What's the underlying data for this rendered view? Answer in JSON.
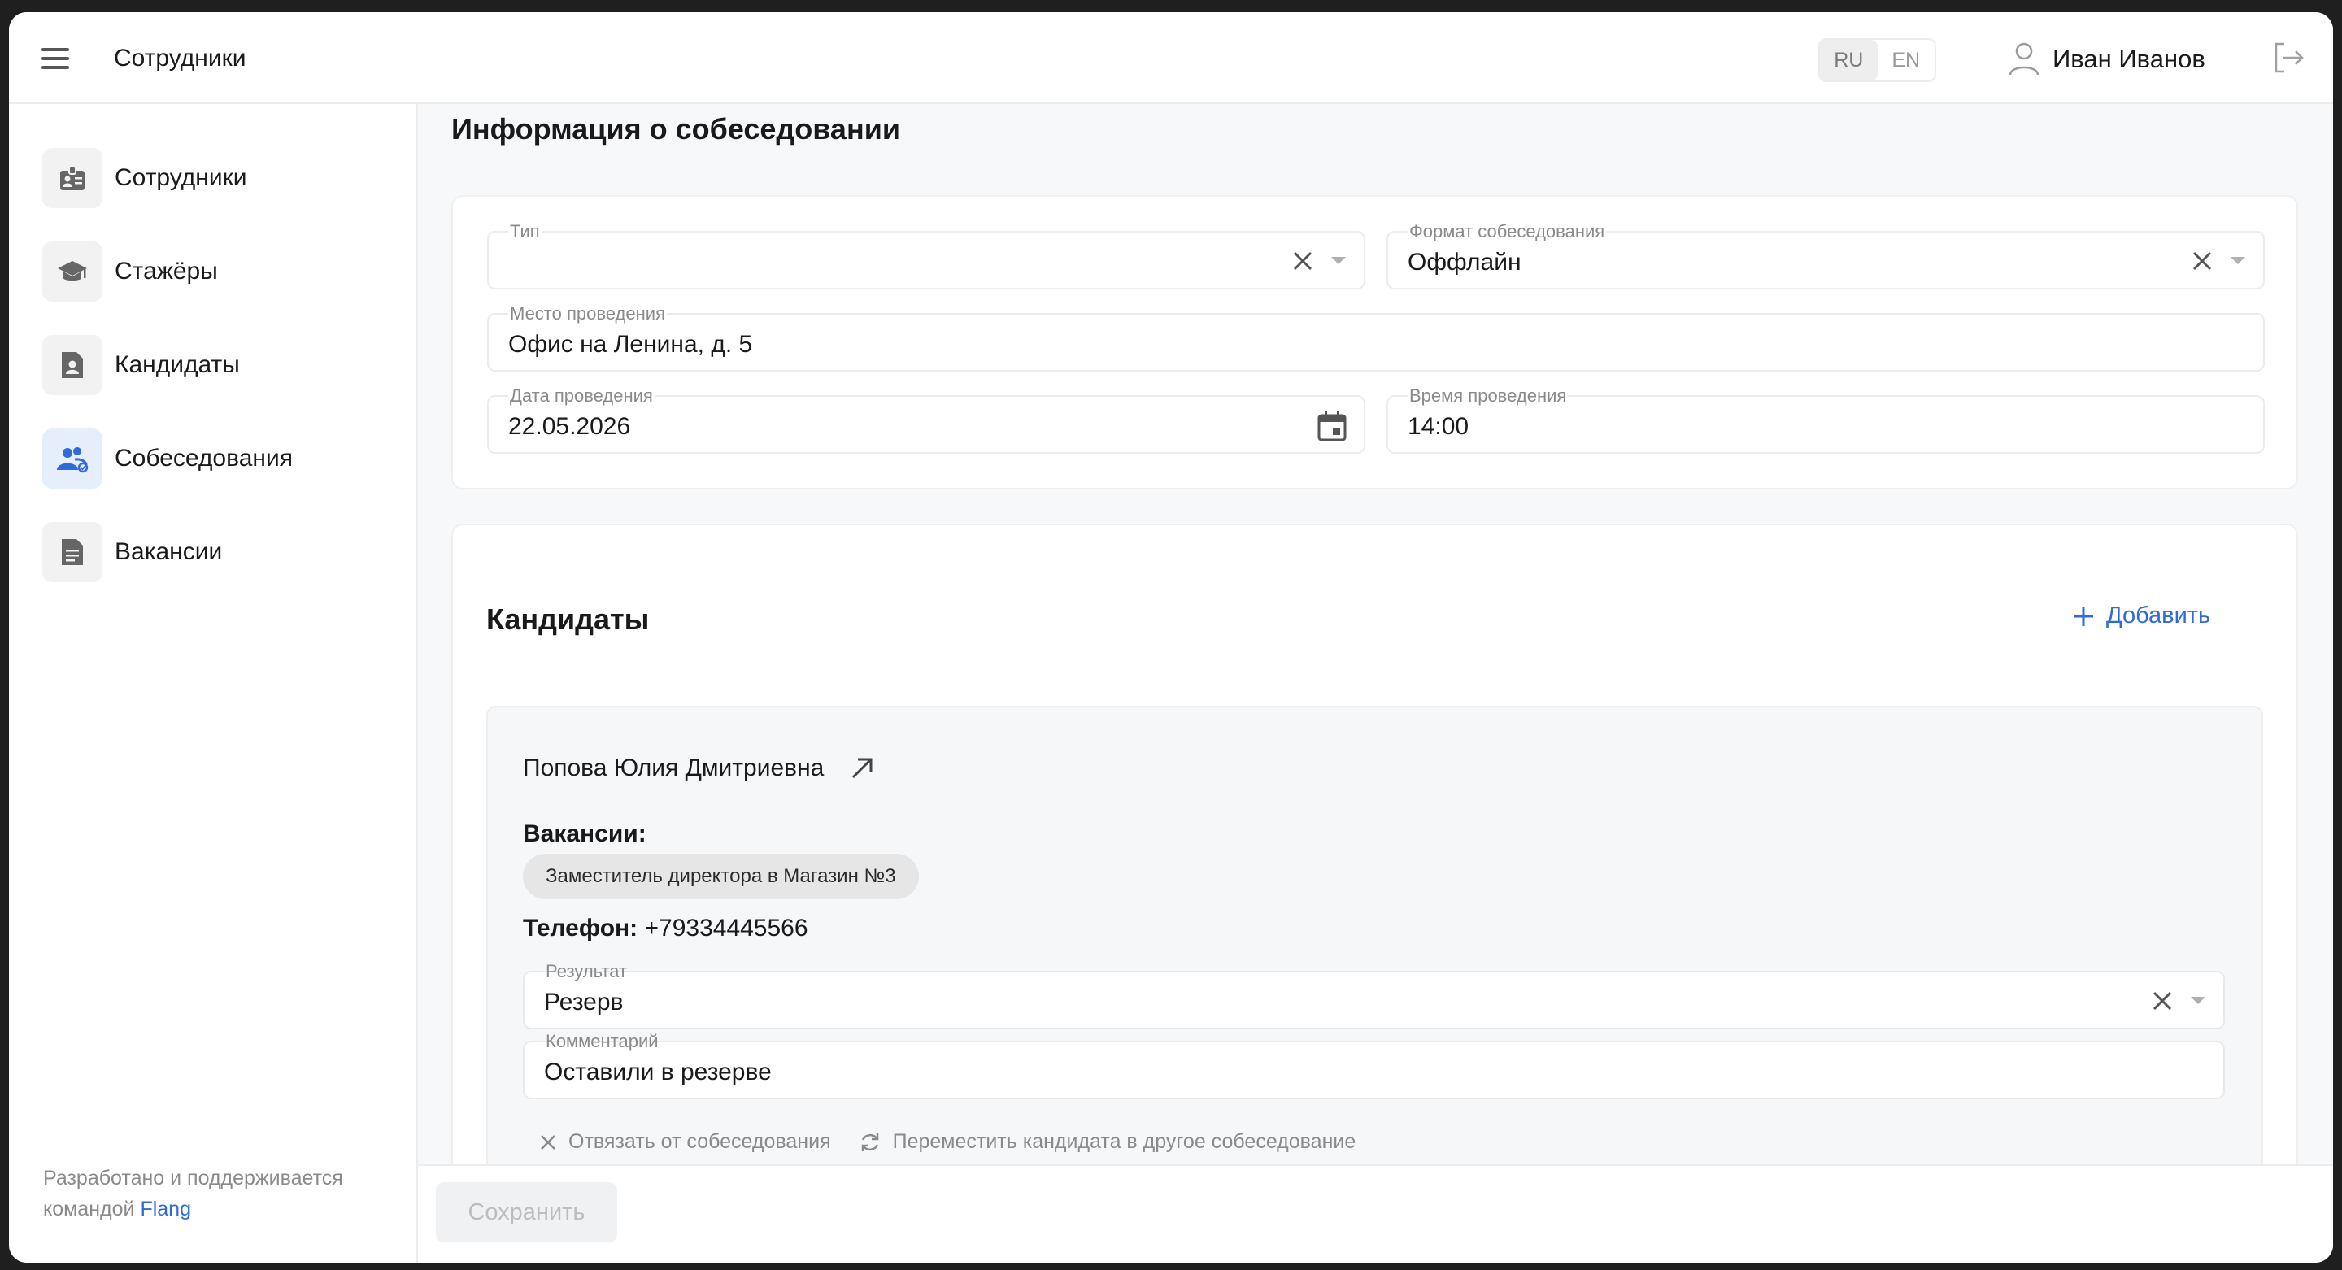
{
  "header": {
    "app_title": "Сотрудники",
    "languages": [
      "RU",
      "EN"
    ],
    "active_language": "RU",
    "user_name": "Иван Иванов"
  },
  "sidebar": {
    "items": [
      {
        "label": "Сотрудники",
        "icon": "badge-icon"
      },
      {
        "label": "Стажёры",
        "icon": "graduation-cap-icon"
      },
      {
        "label": "Кандидаты",
        "icon": "person-document-icon"
      },
      {
        "label": "Собеседования",
        "icon": "group-icon",
        "active": true
      },
      {
        "label": "Вакансии",
        "icon": "document-icon"
      }
    ],
    "footer_text": "Разработано и поддерживается командой",
    "footer_link": "Flang"
  },
  "interview_info": {
    "title": "Информация о собеседовании",
    "type": {
      "label": "Тип",
      "value": ""
    },
    "format": {
      "label": "Формат собеседования",
      "value": "Оффлайн"
    },
    "place": {
      "label": "Место проведения",
      "value": "Офис на Ленина, д. 5"
    },
    "date": {
      "label": "Дата проведения",
      "value": "22.05.2026"
    },
    "time": {
      "label": "Время проведения",
      "value": "14:00"
    }
  },
  "candidates": {
    "title": "Кандидаты",
    "add_label": "Добавить",
    "items": [
      {
        "name": "Попова Юлия Дмитриевна",
        "vacancies_label": "Вакансии:",
        "vacancy": "Заместитель директора в Магазин №3",
        "phone_label": "Телефон:",
        "phone": "+79334445566",
        "result": {
          "label": "Результат",
          "value": "Резерв"
        },
        "comment": {
          "label": "Комментарий",
          "value": "Оставили в резерве"
        },
        "unlink_label": "Отвязать от собеседования",
        "move_label": "Переместить кандидата в другое собеседование"
      }
    ]
  },
  "save_label": "Сохранить",
  "colors": {
    "accent": "#2f6bd8",
    "background": "#f7f8fa",
    "active_nav": "#e6eefc"
  }
}
